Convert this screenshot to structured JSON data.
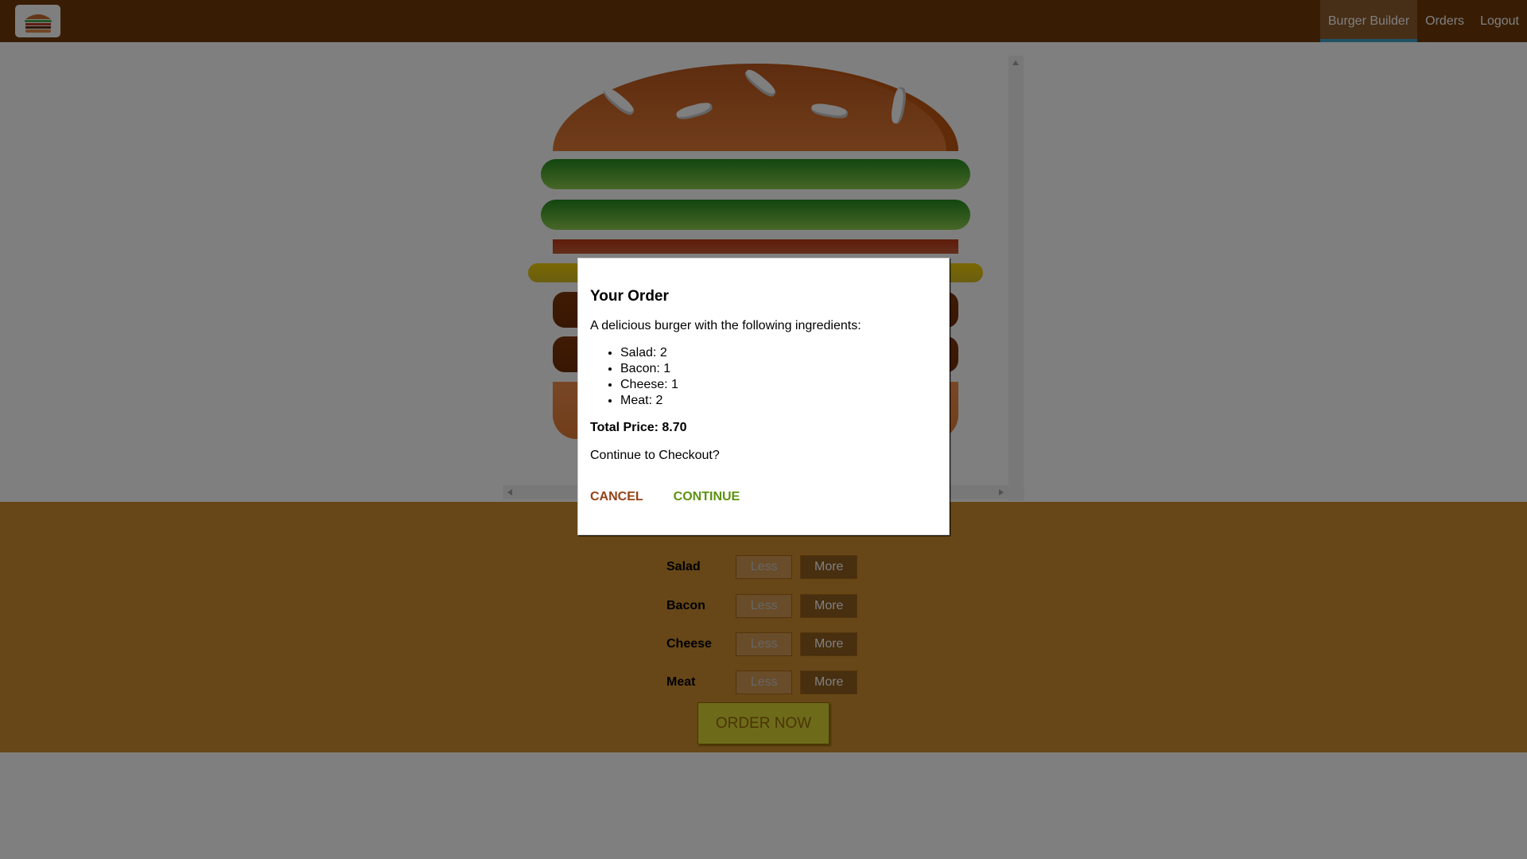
{
  "toolbar": {
    "nav": [
      {
        "label": "Burger Builder",
        "active": true
      },
      {
        "label": "Orders",
        "active": false
      },
      {
        "label": "Logout",
        "active": false
      }
    ],
    "logo_icon": "burger-logo-icon"
  },
  "burger": {
    "layers": [
      "salad",
      "salad",
      "bacon",
      "cheese",
      "meat",
      "meat"
    ]
  },
  "controls": [
    {
      "label": "Salad",
      "less": "Less",
      "more": "More"
    },
    {
      "label": "Bacon",
      "less": "Less",
      "more": "More"
    },
    {
      "label": "Cheese",
      "less": "Less",
      "more": "More"
    },
    {
      "label": "Meat",
      "less": "Less",
      "more": "More"
    }
  ],
  "order_button": "ORDER NOW",
  "modal": {
    "title": "Your Order",
    "description": "A delicious burger with the following ingredients:",
    "ingredients": [
      "Salad: 2",
      "Bacon: 1",
      "Cheese: 1",
      "Meat: 2"
    ],
    "total_price": "Total Price: 8.70",
    "question": "Continue to Checkout?",
    "cancel_label": "CANCEL",
    "continue_label": "CONTINUE"
  },
  "colors": {
    "toolbar": "#703b09",
    "controls_bg": "#cf8f2e",
    "cancel": "#944317",
    "continue": "#5c9210"
  }
}
